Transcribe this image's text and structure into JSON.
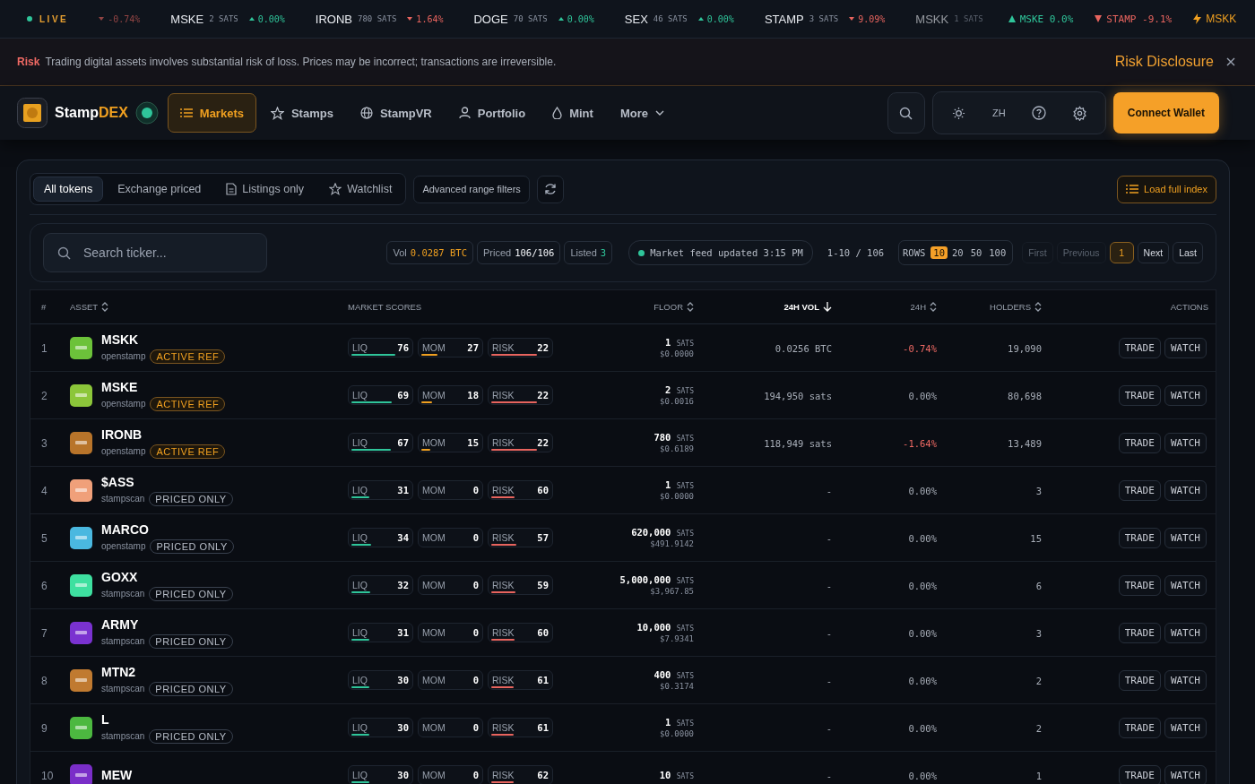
{
  "ticker": {
    "live_label": "LIVE",
    "items": [
      {
        "change": "-0.74%",
        "rising": false,
        "faded": true
      },
      {
        "symbol": "MSKE",
        "price": "2 SATS",
        "change": "0.00%",
        "rising": true,
        "faded": false
      },
      {
        "symbol": "IRONB",
        "price": "780 SATS",
        "change": "1.64%",
        "rising": false,
        "faded": false
      },
      {
        "symbol": "DOGE",
        "price": "70 SATS",
        "change": "0.00%",
        "rising": true,
        "faded": false
      },
      {
        "symbol": "SEX",
        "price": "46 SATS",
        "change": "0.00%",
        "rising": true,
        "faded": false
      },
      {
        "symbol": "STAMP",
        "price": "3 SATS",
        "change": "9.09%",
        "rising": false,
        "faded": false
      },
      {
        "symbol": "MSKK",
        "price": "1 SATS",
        "faded": true
      }
    ],
    "pills": [
      {
        "kind": "up",
        "text": "MSKE 0.0%"
      },
      {
        "kind": "down",
        "text": "STAMP -9.1%"
      },
      {
        "kind": "hot",
        "text": "MSKK"
      }
    ]
  },
  "risk_banner": {
    "tag": "Risk",
    "message": "Trading digital assets involves substantial risk of loss. Prices may be incorrect; transactions are irreversible.",
    "link": "Risk Disclosure"
  },
  "nav": {
    "brand": "Stamp",
    "brand_accent": "DEX",
    "items": [
      {
        "label": "Markets",
        "selected": true
      },
      {
        "label": "Stamps",
        "selected": false
      },
      {
        "label": "StampVR",
        "selected": false
      },
      {
        "label": "Portfolio",
        "selected": false
      },
      {
        "label": "Mint",
        "selected": false
      },
      {
        "label": "More",
        "selected": false
      }
    ],
    "language": "ZH",
    "connect": "Connect Wallet"
  },
  "filters": {
    "tabs": [
      {
        "label": "All tokens",
        "selected": true
      },
      {
        "label": "Exchange priced",
        "selected": false
      },
      {
        "label": "Listings only",
        "selected": false
      },
      {
        "label": "Watchlist",
        "selected": false
      }
    ],
    "advanced": "Advanced range filters",
    "load": "Load full index"
  },
  "toolbar": {
    "search": {
      "placeholder": "Search ticker..."
    },
    "stats": [
      {
        "label": "Vol",
        "value": "0.0287 BTC",
        "color": "#f0a020"
      },
      {
        "label": "Priced",
        "value": "106/106",
        "color": "#f2f4f8"
      },
      {
        "label": "Listed",
        "value": "3",
        "color": "#2fc59a"
      }
    ],
    "feed": {
      "live": true,
      "text": "Market feed updated 3:15 PM"
    },
    "range": "1-10 / 106",
    "rows_label": "ROWS",
    "rows_options": [
      {
        "label": "10",
        "selected": true
      },
      {
        "label": "20",
        "selected": false
      },
      {
        "label": "50",
        "selected": false
      },
      {
        "label": "100",
        "selected": false
      }
    ],
    "pages": [
      {
        "label": "First",
        "disabled": true,
        "selected": false
      },
      {
        "label": "Previous",
        "disabled": true,
        "selected": false
      },
      {
        "label": "1",
        "disabled": false,
        "selected": true
      },
      {
        "label": "Next",
        "disabled": false,
        "selected": false
      },
      {
        "label": "Last",
        "disabled": false,
        "selected": false
      }
    ]
  },
  "table": {
    "columns": [
      {
        "label": "#",
        "sortable": false,
        "active": false
      },
      {
        "label": "ASSET",
        "sortable": true,
        "active": false
      },
      {
        "label": "MARKET SCORES",
        "sortable": false,
        "active": false
      },
      {
        "label": "FLOOR",
        "sortable": true,
        "active": false
      },
      {
        "label": "24H VOL",
        "sortable": true,
        "active": true
      },
      {
        "label": "24H",
        "sortable": true,
        "active": false
      },
      {
        "label": "HOLDERS",
        "sortable": true,
        "active": false
      },
      {
        "label": "ACTIONS",
        "sortable": false,
        "active": false
      }
    ],
    "rows": [
      {
        "index": "1",
        "name": "MSKK",
        "color": "#6cc23a",
        "source": "openstamp",
        "badge": {
          "kind": "active",
          "text": "ACTIVE REF"
        },
        "scores": [
          {
            "kind": "liq",
            "label": "LIQ",
            "value": "76",
            "level": 0.76
          },
          {
            "kind": "mom",
            "label": "MOM",
            "value": "27",
            "level": 0.27
          },
          {
            "kind": "risk",
            "label": "RISK",
            "value": "22",
            "level": 0.78
          }
        ],
        "floor": "1",
        "unit": "SATS",
        "usd": "$0.0000",
        "volume": "0.0256 BTC",
        "change": "-0.74%",
        "negative": true,
        "holders": "19,090",
        "actions": [
          "TRADE",
          "WATCH"
        ]
      },
      {
        "index": "2",
        "name": "MSKE",
        "color": "#8cc63a",
        "source": "openstamp",
        "badge": {
          "kind": "active",
          "text": "ACTIVE REF"
        },
        "scores": [
          {
            "kind": "liq",
            "label": "LIQ",
            "value": "69",
            "level": 0.69
          },
          {
            "kind": "mom",
            "label": "MOM",
            "value": "18",
            "level": 0.18
          },
          {
            "kind": "risk",
            "label": "RISK",
            "value": "22",
            "level": 0.78
          }
        ],
        "floor": "2",
        "unit": "SATS",
        "usd": "$0.0016",
        "volume": "194,950 sats",
        "change": "0.00%",
        "negative": false,
        "holders": "80,698",
        "actions": [
          "TRADE",
          "WATCH"
        ]
      },
      {
        "index": "3",
        "name": "IRONB",
        "color": "#b8742a",
        "source": "openstamp",
        "badge": {
          "kind": "active",
          "text": "ACTIVE REF"
        },
        "scores": [
          {
            "kind": "liq",
            "label": "LIQ",
            "value": "67",
            "level": 0.67
          },
          {
            "kind": "mom",
            "label": "MOM",
            "value": "15",
            "level": 0.15
          },
          {
            "kind": "risk",
            "label": "RISK",
            "value": "22",
            "level": 0.78
          }
        ],
        "floor": "780",
        "unit": "SATS",
        "usd": "$0.6189",
        "volume": "118,949 sats",
        "change": "-1.64%",
        "negative": true,
        "holders": "13,489",
        "actions": [
          "TRADE",
          "WATCH"
        ]
      },
      {
        "index": "4",
        "name": "$ASS",
        "color": "#f0a07a",
        "source": "stampscan",
        "badge": {
          "kind": "priced",
          "text": "PRICED ONLY"
        },
        "scores": [
          {
            "kind": "liq",
            "label": "LIQ",
            "value": "31",
            "level": 0.31
          },
          {
            "kind": "mom",
            "label": "MOM",
            "value": "0",
            "level": 0
          },
          {
            "kind": "risk",
            "label": "RISK",
            "value": "60",
            "level": 0.4
          }
        ],
        "floor": "1",
        "unit": "SATS",
        "usd": "$0.0000",
        "volume": "-",
        "change": "0.00%",
        "negative": false,
        "holders": "3",
        "actions": [
          "TRADE",
          "WATCH"
        ]
      },
      {
        "index": "5",
        "name": "MARCO",
        "color": "#4ab8e0",
        "source": "openstamp",
        "badge": {
          "kind": "priced",
          "text": "PRICED ONLY"
        },
        "scores": [
          {
            "kind": "liq",
            "label": "LIQ",
            "value": "34",
            "level": 0.34
          },
          {
            "kind": "mom",
            "label": "MOM",
            "value": "0",
            "level": 0
          },
          {
            "kind": "risk",
            "label": "RISK",
            "value": "57",
            "level": 0.43
          }
        ],
        "floor": "620,000",
        "unit": "SATS",
        "usd": "$491.9142",
        "volume": "-",
        "change": "0.00%",
        "negative": false,
        "holders": "15",
        "actions": [
          "TRADE",
          "WATCH"
        ]
      },
      {
        "index": "6",
        "name": "GOXX",
        "color": "#3ee0a0",
        "source": "stampscan",
        "badge": {
          "kind": "priced",
          "text": "PRICED ONLY"
        },
        "scores": [
          {
            "kind": "liq",
            "label": "LIQ",
            "value": "32",
            "level": 0.32
          },
          {
            "kind": "mom",
            "label": "MOM",
            "value": "0",
            "level": 0
          },
          {
            "kind": "risk",
            "label": "RISK",
            "value": "59",
            "level": 0.41
          }
        ],
        "floor": "5,000,000",
        "unit": "SATS",
        "usd": "$3,967.85",
        "volume": "-",
        "change": "0.00%",
        "negative": false,
        "holders": "6",
        "actions": [
          "TRADE",
          "WATCH"
        ]
      },
      {
        "index": "7",
        "name": "ARMY",
        "color": "#7a32d0",
        "source": "stampscan",
        "badge": {
          "kind": "priced",
          "text": "PRICED ONLY"
        },
        "scores": [
          {
            "kind": "liq",
            "label": "LIQ",
            "value": "31",
            "level": 0.31
          },
          {
            "kind": "mom",
            "label": "MOM",
            "value": "0",
            "level": 0
          },
          {
            "kind": "risk",
            "label": "RISK",
            "value": "60",
            "level": 0.4
          }
        ],
        "floor": "10,000",
        "unit": "SATS",
        "usd": "$7.9341",
        "volume": "-",
        "change": "0.00%",
        "negative": false,
        "holders": "3",
        "actions": [
          "TRADE",
          "WATCH"
        ]
      },
      {
        "index": "8",
        "name": "MTN2",
        "color": "#c07a30",
        "source": "stampscan",
        "badge": {
          "kind": "priced",
          "text": "PRICED ONLY"
        },
        "scores": [
          {
            "kind": "liq",
            "label": "LIQ",
            "value": "30",
            "level": 0.3
          },
          {
            "kind": "mom",
            "label": "MOM",
            "value": "0",
            "level": 0
          },
          {
            "kind": "risk",
            "label": "RISK",
            "value": "61",
            "level": 0.39
          }
        ],
        "floor": "400",
        "unit": "SATS",
        "usd": "$0.3174",
        "volume": "-",
        "change": "0.00%",
        "negative": false,
        "holders": "2",
        "actions": [
          "TRADE",
          "WATCH"
        ]
      },
      {
        "index": "9",
        "name": "L",
        "color": "#4cb840",
        "source": "stampscan",
        "badge": {
          "kind": "priced",
          "text": "PRICED ONLY"
        },
        "scores": [
          {
            "kind": "liq",
            "label": "LIQ",
            "value": "30",
            "level": 0.3
          },
          {
            "kind": "mom",
            "label": "MOM",
            "value": "0",
            "level": 0
          },
          {
            "kind": "risk",
            "label": "RISK",
            "value": "61",
            "level": 0.39
          }
        ],
        "floor": "1",
        "unit": "SATS",
        "usd": "$0.0000",
        "volume": "-",
        "change": "0.00%",
        "negative": false,
        "holders": "2",
        "actions": [
          "TRADE",
          "WATCH"
        ]
      },
      {
        "index": "10",
        "name": "MEW",
        "color": "#7a2ec8",
        "scores": [
          {
            "kind": "liq",
            "label": "LIQ",
            "value": "30",
            "level": 0.3
          },
          {
            "kind": "mom",
            "label": "MOM",
            "value": "0",
            "level": 0
          },
          {
            "kind": "risk",
            "label": "RISK",
            "value": "62",
            "level": 0.38
          }
        ],
        "floor": "10",
        "unit": "SATS",
        "volume": "-",
        "change": "0.00%",
        "negative": false,
        "holders": "1",
        "actions": [
          "TRADE",
          "WATCH"
        ]
      }
    ]
  }
}
